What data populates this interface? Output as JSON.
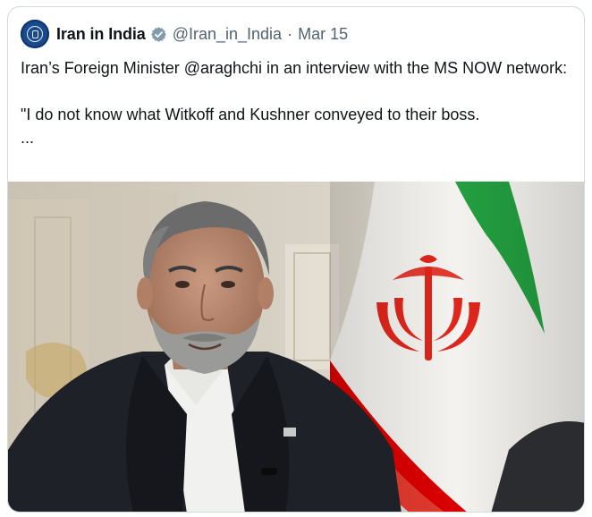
{
  "tweet": {
    "display_name": "Iran in India",
    "handle": "@Iran_in_India",
    "separator": "·",
    "date": "Mar 15",
    "text_line1": "Iran’s Foreign Minister @araghchi in an interview with the MS NOW network:",
    "text_line2": "\"I do not know what Witkoff and Kushner conveyed to their boss.",
    "text_more": "...",
    "verified_badge_color": "#829aab"
  },
  "icons": {
    "avatar": "embassy-emblem-icon",
    "verified": "verified-badge-icon"
  },
  "colors": {
    "text_primary": "#0f1419",
    "text_secondary": "#536471",
    "border": "#cfd9de",
    "flag_green": "#239f40",
    "flag_white": "#ffffff",
    "flag_red": "#da0000"
  }
}
